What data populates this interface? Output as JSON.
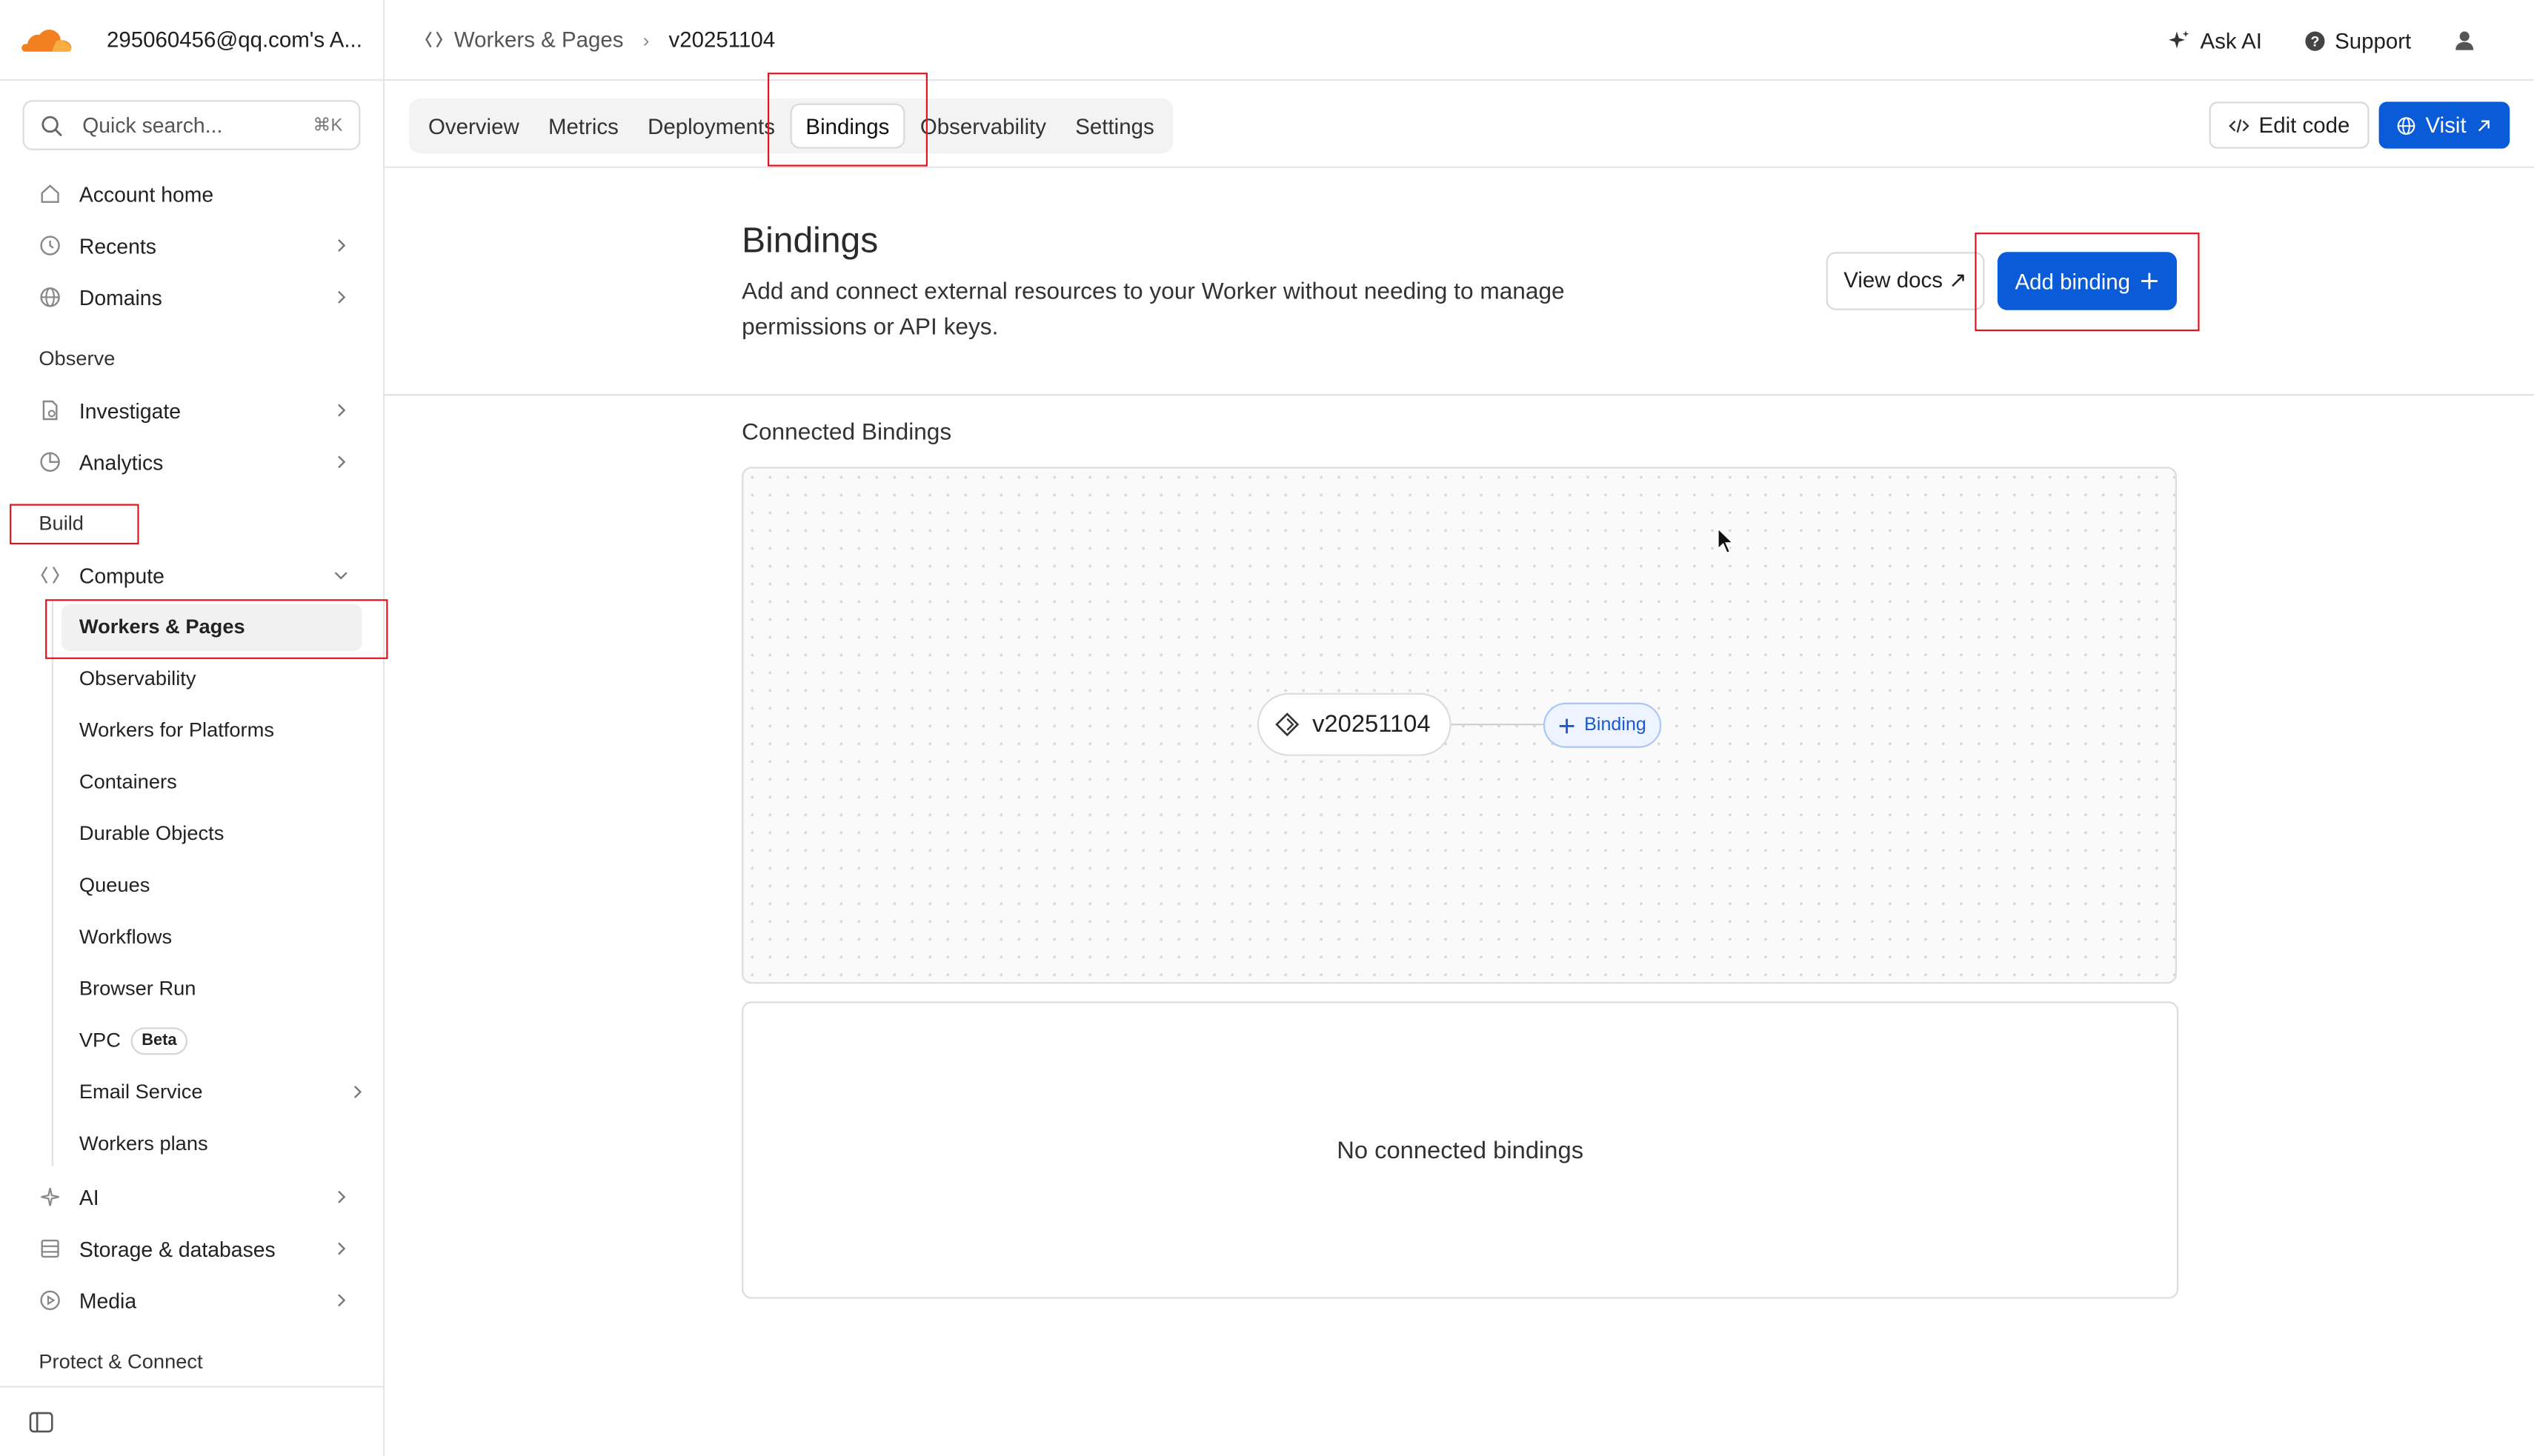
{
  "account": {
    "name": "295060456@qq.com's A..."
  },
  "search": {
    "placeholder": "Quick search...",
    "shortcut": "⌘K"
  },
  "sidebar": {
    "top_items": [
      {
        "label": "Account home",
        "icon": "home-icon"
      },
      {
        "label": "Recents",
        "icon": "clock-icon"
      },
      {
        "label": "Domains",
        "icon": "globe-icon"
      }
    ],
    "sections": {
      "observe": "Observe",
      "build": "Build",
      "protect": "Protect & Connect"
    },
    "observe_items": [
      {
        "label": "Investigate",
        "icon": "document-search-icon"
      },
      {
        "label": "Analytics",
        "icon": "pie-chart-icon"
      }
    ],
    "compute": {
      "label": "Compute",
      "icon": "compute-icon"
    },
    "compute_sub": [
      "Workers & Pages",
      "Observability",
      "Workers for Platforms",
      "Containers",
      "Durable Objects",
      "Queues",
      "Workflows",
      "Browser Run",
      "VPC",
      "Email Service",
      "Workers plans"
    ],
    "vpc_badge": "Beta",
    "build_items": [
      {
        "label": "AI",
        "icon": "sparkle-icon"
      },
      {
        "label": "Storage & databases",
        "icon": "database-icon"
      },
      {
        "label": "Media",
        "icon": "play-circle-icon"
      }
    ]
  },
  "header": {
    "breadcrumb": [
      "Workers & Pages",
      "v20251104"
    ],
    "ask_ai": "Ask AI",
    "support": "Support"
  },
  "tabs": [
    "Overview",
    "Metrics",
    "Deployments",
    "Bindings",
    "Observability",
    "Settings"
  ],
  "active_tab": "Bindings",
  "actions": {
    "edit_code": "Edit code",
    "visit": "Visit"
  },
  "main": {
    "title": "Bindings",
    "description": "Add and connect external resources to your Worker without needing to manage permissions or API keys.",
    "view_docs": "View docs ↗",
    "add_binding": "Add binding",
    "connected_title": "Connected Bindings",
    "node_label": "v20251104",
    "binding_pill": "Binding",
    "empty_text": "No connected bindings"
  },
  "colors": {
    "accent": "#0a5bd8",
    "highlight": "#e0131c",
    "brand_orange": "#f38020"
  }
}
